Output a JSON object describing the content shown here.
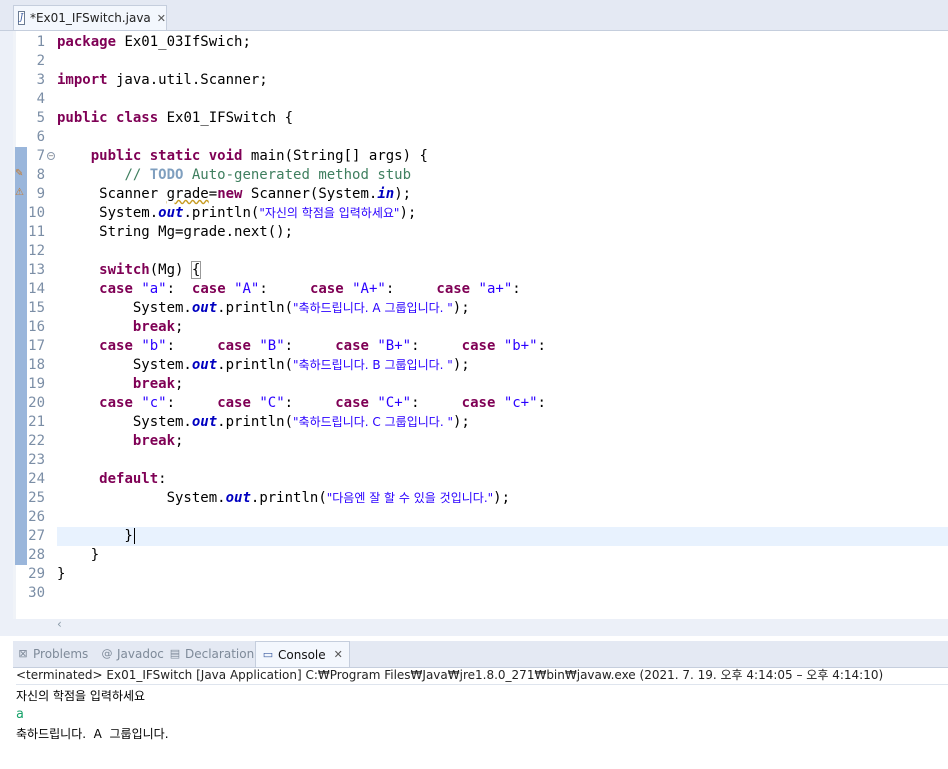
{
  "editor_tab": {
    "title": "*Ex01_IFSwitch.java",
    "icon": "java-file-icon"
  },
  "code": {
    "line_numbers": [
      "1",
      "2",
      "3",
      "4",
      "5",
      "6",
      "7",
      "8",
      "9",
      "10",
      "11",
      "12",
      "13",
      "14",
      "15",
      "16",
      "17",
      "18",
      "19",
      "20",
      "21",
      "22",
      "23",
      "24",
      "25",
      "26",
      "27",
      "28",
      "29",
      "30"
    ],
    "l1_kw": "package",
    "l1_rest": " Ex01_03IfSwich;",
    "l3_kw": "import",
    "l3_rest": " java.util.Scanner;",
    "l5_kw1": "public",
    "l5_kw2": "class",
    "l5_rest": " Ex01_IFSwitch {",
    "l7_kw1": "public",
    "l7_kw2": "static",
    "l7_kw3": "void",
    "l7_rest": " main(String[] args) {",
    "l8_cm1": "// ",
    "l8_todo": "TODO",
    "l8_cm2": " Auto-generated method stub",
    "l9_a": "Scanner ",
    "l9_var": "grade",
    "l9_eq": "=",
    "l9_kw": "new",
    "l9_b": " Scanner(System.",
    "l9_field": "in",
    "l9_c": ");",
    "l10_a": "System.",
    "l10_field": "out",
    "l10_b": ".println(",
    "l10_str": "\"자신의 학점을 입력하세요\"",
    "l10_c": ");",
    "l11": "String Mg=grade.next();",
    "l13_kw": "switch",
    "l13_rest": "(Mg) ",
    "l13_brace": "{",
    "case": "case",
    "break": "break",
    "default": "default",
    "l14": [
      "\"a\"",
      "\"A\"",
      "\"A+\"",
      "\"a+\""
    ],
    "l15_str": "\"축하드립니다. A 그룹입니다. \"",
    "l17": [
      "\"b\"",
      "\"B\"",
      "\"B+\"",
      "\"b+\""
    ],
    "l18_str": "\"축하드립니다. B 그룹입니다. \"",
    "l20": [
      "\"c\"",
      "\"C\"",
      "\"C+\"",
      "\"c+\""
    ],
    "l21_str": "\"축하드립니다. C 그룹입니다. \"",
    "l25_str": "\"다음엔 잘 할 수 있을 것입니다.\"",
    "sys": "System.",
    "out": "out",
    "println": ".println(",
    "close": ");"
  },
  "views": {
    "tabs": [
      {
        "label": "Problems",
        "icon": "problems-icon"
      },
      {
        "label": "Javadoc",
        "icon": "javadoc-icon"
      },
      {
        "label": "Declaration",
        "icon": "declaration-icon"
      },
      {
        "label": "Console",
        "icon": "console-icon"
      }
    ],
    "active": "Console"
  },
  "console": {
    "status": "<terminated> Ex01_IFSwitch [Java Application] C:₩Program Files₩Java₩jre1.8.0_271₩bin₩javaw.exe  (2021. 7. 19. 오후 4:14:05 – 오후 4:14:10)",
    "lines": [
      "자신의 학점을 입력하세요",
      "a",
      "축하드립니다.  A  그룹입니다."
    ]
  },
  "colors": {
    "keyword": "#7f0055",
    "string": "#2a00ff",
    "comment": "#3f7f5f",
    "field": "#0000c0",
    "console_input": "#18a26a"
  }
}
